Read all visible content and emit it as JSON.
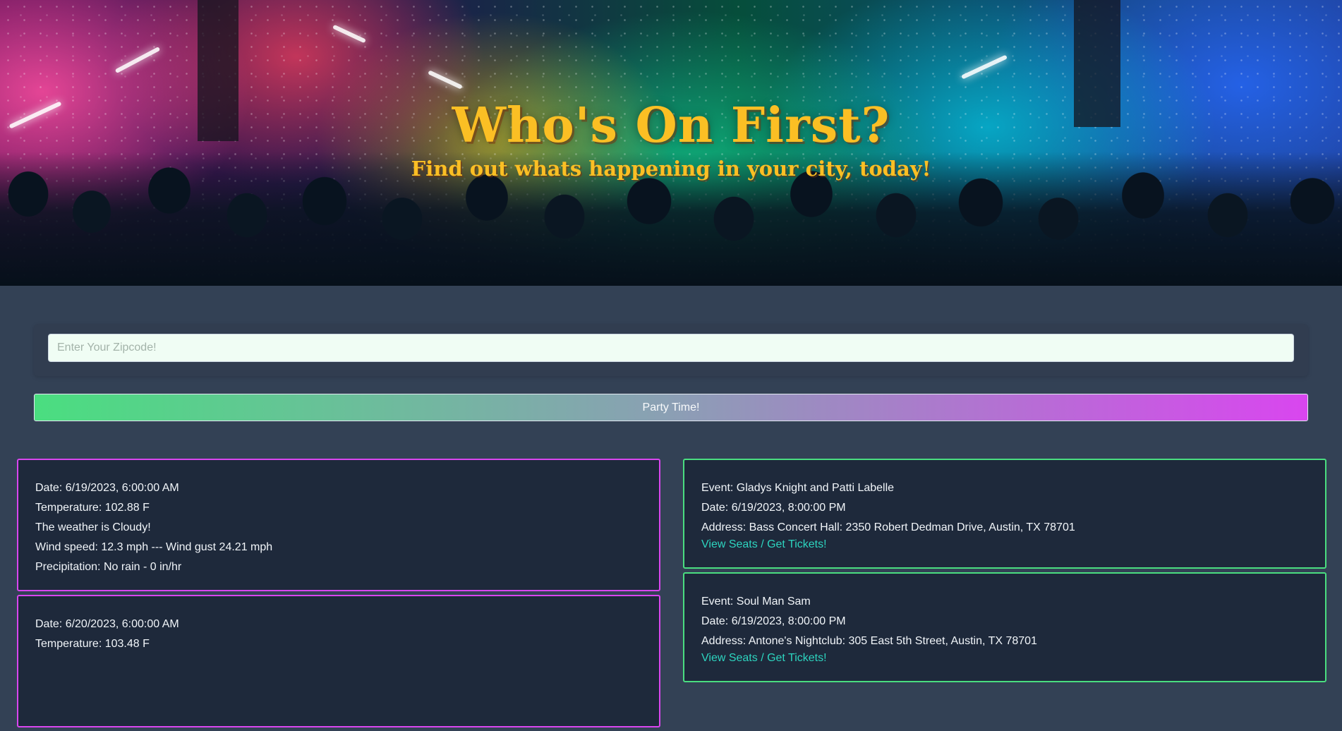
{
  "hero": {
    "title": "Who's On First?",
    "subtitle": "Find out whats happening in your city, today!"
  },
  "search": {
    "placeholder": "Enter Your Zipcode!",
    "value": ""
  },
  "party_button": {
    "label": "Party Time!"
  },
  "weather": [
    {
      "date": "Date: 6/19/2023, 6:00:00 AM",
      "temperature": "Temperature: 102.88 F",
      "condition": "The weather is Cloudy!",
      "wind": "Wind speed: 12.3 mph --- Wind gust 24.21 mph",
      "precipitation": "Precipitation: No rain - 0 in/hr"
    },
    {
      "date": "Date: 6/20/2023, 6:00:00 AM",
      "temperature": "Temperature: 103.48 F",
      "condition": "",
      "wind": "",
      "precipitation": ""
    }
  ],
  "events": [
    {
      "event": "Event: Gladys Knight and Patti Labelle",
      "date": "Date: 6/19/2023, 8:00:00 PM",
      "address": "Address: Bass Concert Hall: 2350 Robert Dedman Drive, Austin, TX 78701",
      "link": "View Seats / Get Tickets!"
    },
    {
      "event": "Event: Soul Man Sam",
      "date": "Date: 6/19/2023, 8:00:00 PM",
      "address": "Address: Antone's Nightclub: 305 East 5th Street, Austin, TX 78701",
      "link": "View Seats / Get Tickets!"
    }
  ],
  "colors": {
    "page_background": "#334155",
    "card_background": "#1e293b",
    "weather_border": "#d946ef",
    "event_border": "#4ade80",
    "link": "#2dd4bf",
    "title": "#fbbf24"
  }
}
